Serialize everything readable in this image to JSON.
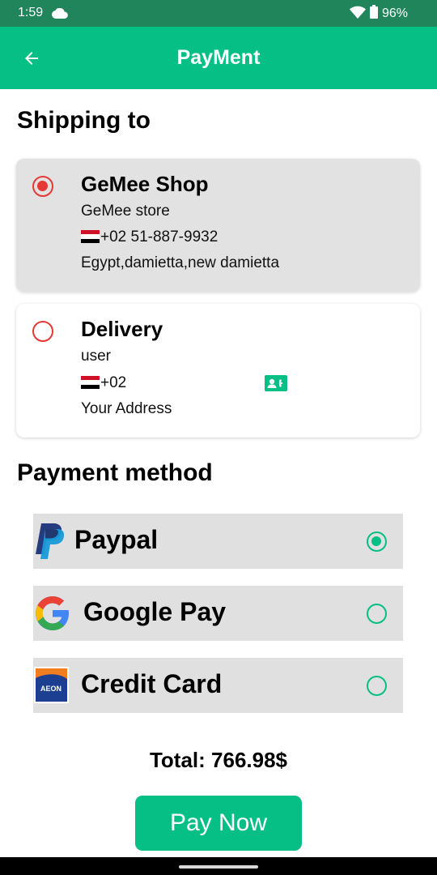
{
  "status_bar": {
    "time": "1:59",
    "battery": "96%"
  },
  "app_bar": {
    "title": "PayMent"
  },
  "shipping": {
    "title": "Shipping to",
    "options": [
      {
        "name": "GeMee Shop",
        "subtitle": "GeMee store",
        "phone": "+02 51-887-9932",
        "address": "Egypt,damietta,new damietta",
        "selected": true
      },
      {
        "name": "Delivery",
        "subtitle": "user",
        "phone": "+02",
        "address": "Your Address",
        "selected": false
      }
    ]
  },
  "payment": {
    "title": "Payment method",
    "methods": [
      {
        "label": "Paypal",
        "icon": "paypal-icon",
        "selected": true
      },
      {
        "label": "Google Pay",
        "icon": "google-icon",
        "selected": false
      },
      {
        "label": "Credit Card",
        "icon": "credit-card-icon",
        "selected": false
      }
    ]
  },
  "total": "Total: 766.98$",
  "pay_button": "Pay Now",
  "colors": {
    "primary": "#06bf84",
    "status_bar": "#20855a",
    "radio_selected": "#e53935",
    "card_selected": "#e2e2e2"
  }
}
